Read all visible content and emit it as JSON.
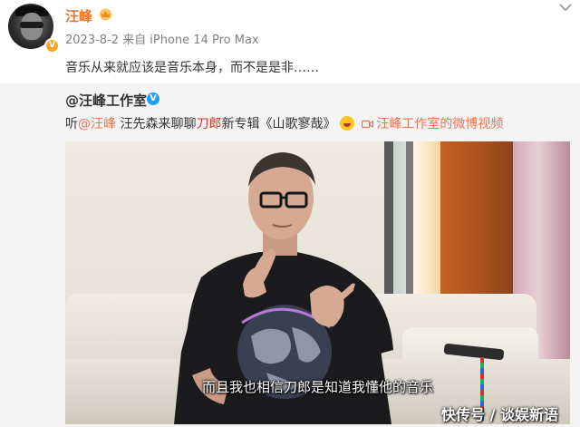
{
  "post": {
    "author": "汪峰",
    "date": "2023-8-2",
    "source": "来自 iPhone 14 Pro Max",
    "text": "音乐从来就应该是音乐本身，而不是是非……"
  },
  "repost": {
    "author": "@汪峰工作室",
    "text_prefix": "听",
    "mention": "@汪峰",
    "text_mid": " 汪先森来聊聊",
    "highlight": "刀郎",
    "text_after": "新专辑《山歌寥哉》",
    "video_link": "汪峰工作室的微博视频"
  },
  "video": {
    "subtitle": "而且我也相信刀郎是知道我懂他的音乐"
  },
  "watermark": "快传号 / 谈娱新语",
  "colors": {
    "author_orange": "#e8732b",
    "link": "#eb7350",
    "highlight_red": "#e0332b",
    "repost_bg": "#f4f4f4",
    "verify_gold": "#f5a623",
    "verify_blue": "#1da1f2"
  },
  "icons": {
    "avatar_badge": "verified-gold-icon",
    "vip": "vip-crown-icon",
    "more": "chevron-down-icon",
    "repost_badge": "verified-blue-icon",
    "emoji": "laughing-emoji-icon",
    "video": "video-camera-icon"
  }
}
